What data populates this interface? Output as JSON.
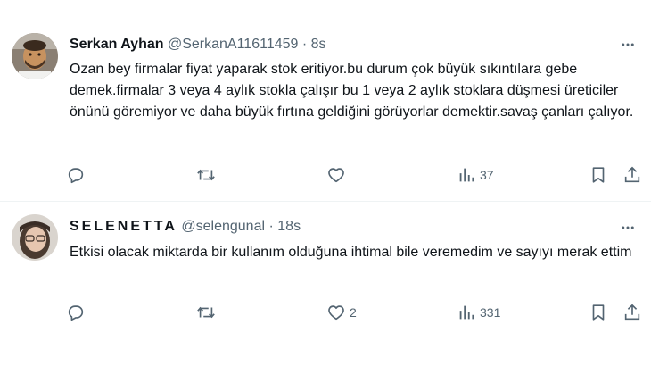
{
  "tweets": [
    {
      "author": "Serkan Ayhan",
      "handle": "@SerkanA11611459",
      "separator": "·",
      "time": "8s",
      "text": "Ozan bey firmalar fiyat yaparak stok eritiyor.bu durum çok büyük sıkıntılara gebe demek.firmalar 3 veya 4 aylık stokla çalışır bu 1 veya 2 aylık stoklara düşmesi üreticiler önünü göremiyor ve daha büyük fırtına geldiğini görüyorlar demektir.savaş çanları çalıyor.",
      "likes": "",
      "views": "37"
    },
    {
      "author": "SELENETTA",
      "handle": "@selengunal",
      "separator": "·",
      "time": "18s",
      "text": "Etkisi olacak miktarda bir kullanım olduğuna ihtimal bile veremedim ve sayıyı merak ettim",
      "likes": "2",
      "views": "331"
    }
  ],
  "icons": {
    "more": "more-icon",
    "reply": "reply-icon",
    "retweet": "retweet-icon",
    "like": "heart-icon",
    "views": "views-icon",
    "bookmark": "bookmark-icon",
    "share": "share-icon"
  },
  "colors": {
    "text": "#0f1419",
    "muted": "#536471",
    "divider": "#eff3f4"
  }
}
